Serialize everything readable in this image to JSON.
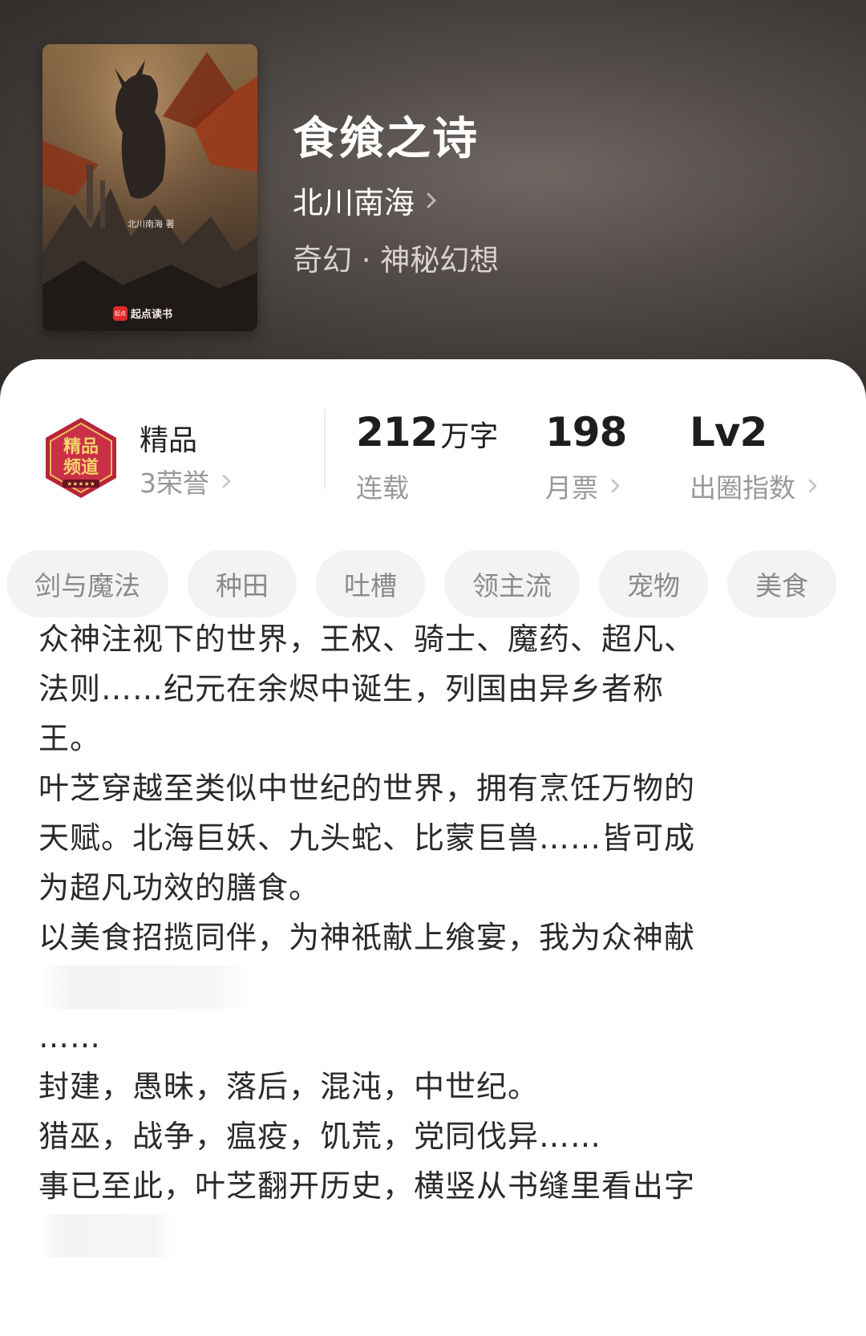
{
  "book": {
    "title": "食飨之诗",
    "author": "北川南海",
    "genre": "奇幻 · 神秘幻想",
    "cover": {
      "author_credit": "北川南海 著",
      "brand_mark": "起点",
      "brand": "起点读书"
    }
  },
  "honor": {
    "badge_icon": "premium-channel-badge",
    "badge_text": "精品频道",
    "title": "精品",
    "count_label": "3荣誉"
  },
  "stats": {
    "words": {
      "value": "212",
      "unit": "万字",
      "label": "连载"
    },
    "monthly_tickets": {
      "value": "198",
      "label": "月票"
    },
    "index": {
      "value": "Lv2",
      "label": "出圈指数"
    }
  },
  "tags": [
    "剑与魔法",
    "种田",
    "吐槽",
    "领主流",
    "宠物",
    "美食"
  ],
  "description": [
    "众神注视下的世界，王权、骑士、魔药、超凡、",
    "法则……纪元在余烬中诞生，列国由异乡者称",
    "王。",
    "叶芝穿越至类似中世纪的世界，拥有烹饪万物的",
    "天赋。北海巨妖、九头蛇、比蒙巨兽……皆可成",
    "为超凡功效的膳食。",
    "以美食招揽同伴，为神祇献上飨宴，我为众神献",
    "",
    "……",
    "封建，愚昧，落后，混沌，中世纪。",
    "猎巫，战争，瘟疫，饥荒，党同伐异……",
    "事已至此，叶芝翻开历史，横竖从书缝里看出字"
  ],
  "colors": {
    "header_bg": "#3a3533",
    "sheet_bg": "#ffffff",
    "tag_bg": "#f3f3f3",
    "badge_red": "#b8243a",
    "badge_gold": "#e8c25a"
  }
}
